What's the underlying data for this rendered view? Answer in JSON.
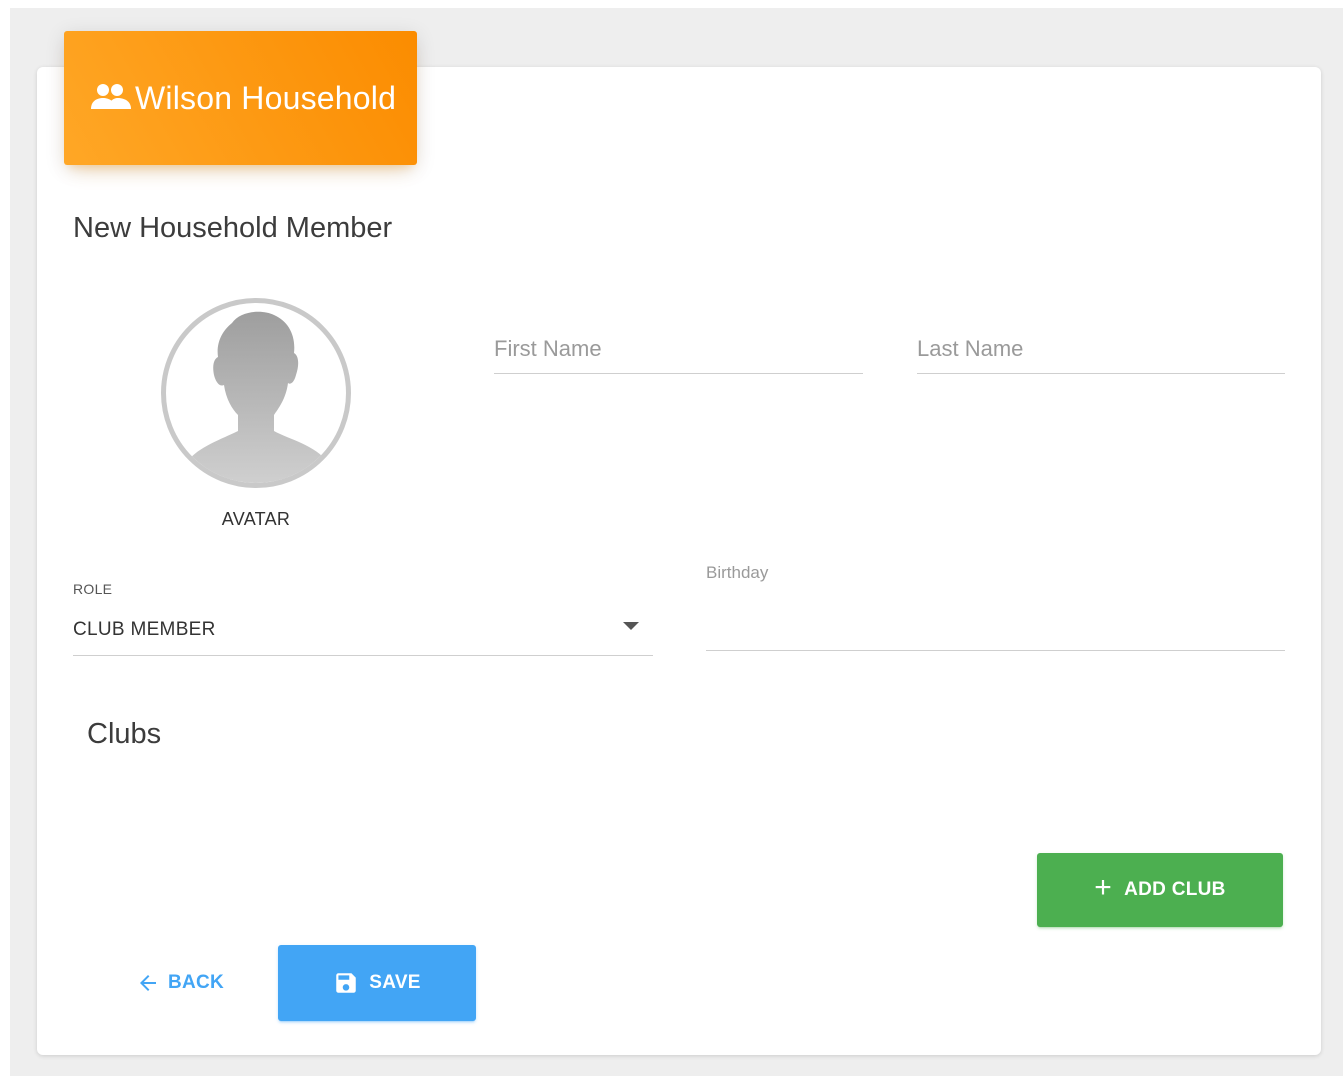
{
  "header": {
    "title": "Wilson Household",
    "icon": "group-icon",
    "color": "#fb8c00"
  },
  "form": {
    "section_title": "New Household Member",
    "avatar": {
      "label": "AVATAR",
      "icon": "person-silhouette"
    },
    "first_name": {
      "placeholder": "First Name",
      "value": ""
    },
    "last_name": {
      "placeholder": "Last Name",
      "value": ""
    },
    "role": {
      "label": "ROLE",
      "value": "CLUB MEMBER"
    },
    "birthday": {
      "label": "Birthday",
      "value": ""
    }
  },
  "clubs": {
    "title": "Clubs",
    "add_label": "ADD CLUB",
    "add_color": "#4caf50"
  },
  "actions": {
    "back_label": "BACK",
    "save_label": "SAVE",
    "save_color": "#42a5f5"
  }
}
